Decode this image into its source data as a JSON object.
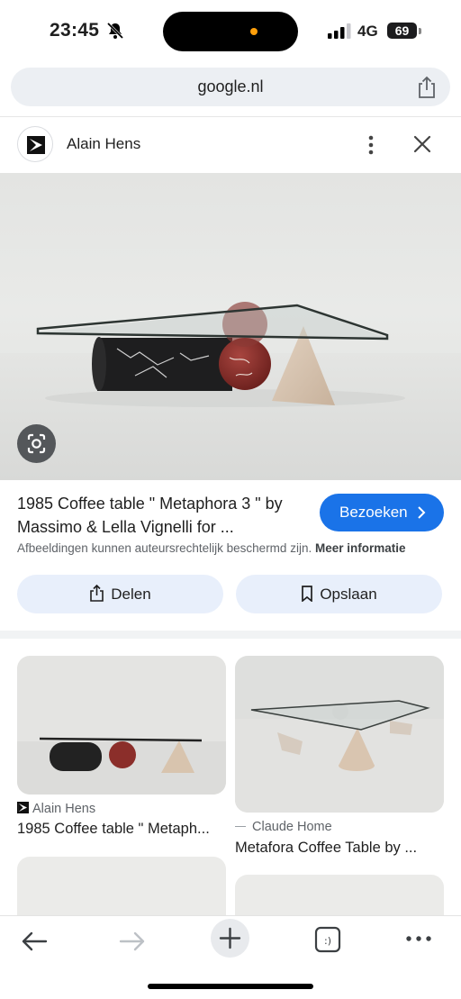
{
  "status": {
    "time": "23:45",
    "network": "4G",
    "battery": "69"
  },
  "browser": {
    "url": "google.nl"
  },
  "source": {
    "name": "Alain Hens"
  },
  "result": {
    "title": "1985 Coffee table \" Metaphora 3 \" by Massimo & Lella Vignelli for ...",
    "visit_label": "Bezoeken",
    "copyright_text": "Afbeeldingen kunnen auteursrechtelijk beschermd zijn.",
    "more_info": "Meer informatie",
    "share_label": "Delen",
    "save_label": "Opslaan"
  },
  "related": [
    {
      "source": "Alain Hens",
      "title": "1985 Coffee table \" Metaph..."
    },
    {
      "source": "Claude Home",
      "title": "Metafora Coffee Table by ..."
    }
  ],
  "icons": [
    "bell-slash-icon",
    "share-icon",
    "more-vert-icon",
    "close-icon",
    "lens-icon",
    "bookmark-icon",
    "back-icon",
    "forward-icon",
    "new-tab-icon",
    "tabs-icon",
    "more-horiz-icon"
  ],
  "colors": {
    "accent": "#1a73e8",
    "action_bg": "#e8effb",
    "url_bg": "#eceff3"
  }
}
